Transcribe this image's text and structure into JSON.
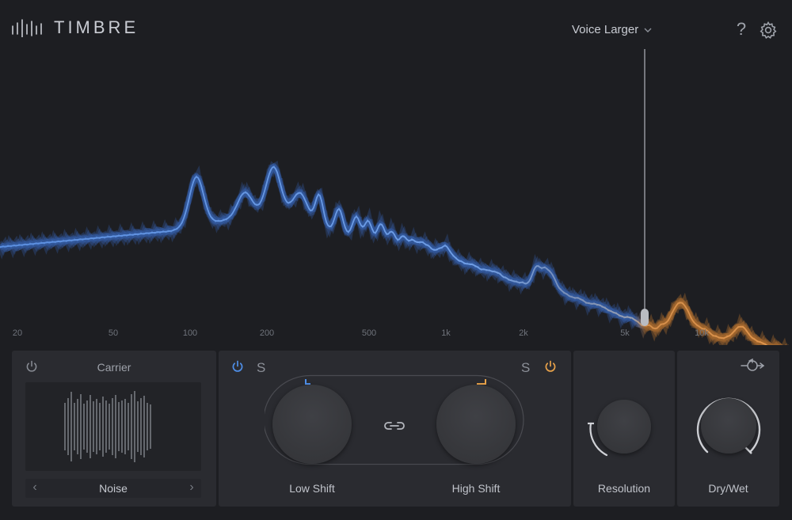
{
  "app": {
    "title": "TIMBRE"
  },
  "header": {
    "preset": "Voice Larger",
    "help_glyph": "?"
  },
  "spectrum": {
    "freq_labels": [
      "20",
      "50",
      "100",
      "200",
      "500",
      "1k",
      "2k",
      "5k",
      "10k"
    ],
    "colors": {
      "low": "#5b8fe0",
      "high": "#d9904a",
      "marker": "#a9acb2"
    }
  },
  "carrier": {
    "title": "Carrier",
    "selected": "Noise",
    "prev": "‹",
    "next": "›"
  },
  "shift": {
    "solo_low": "S",
    "solo_high": "S",
    "low_label": "Low Shift",
    "high_label": "High Shift",
    "low_color": "#4f8fe8",
    "high_color": "#e8a24a"
  },
  "resolution": {
    "label": "Resolution"
  },
  "drywet": {
    "label": "Dry/Wet"
  },
  "icons": {
    "logo": "bars-logo-icon",
    "preset_dropdown": "chevron-down-icon",
    "help": "help-icon",
    "settings": "gear-icon",
    "power": "power-icon",
    "link": "link-icon",
    "feedback": "feedback-route-icon"
  }
}
